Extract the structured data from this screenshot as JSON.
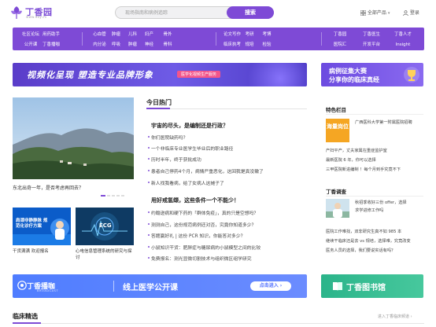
{
  "header": {
    "logo_text": "丁香园",
    "logo_url_text": "www.dxy.cn",
    "search_placeholder": "现场指南和病例追踪",
    "search_button": "搜索",
    "all_products": "全部产品",
    "login": "登录"
  },
  "nav": {
    "groups": [
      {
        "cols": 2,
        "items": [
          "社区论坛",
          "用药助手",
          "公开课",
          "丁香播咖"
        ]
      },
      {
        "cols": 4,
        "items": [
          "心血管",
          "肿瘤",
          "儿科",
          "妇产",
          "内分泌",
          "呼吸",
          "肿瘤",
          "神经"
        ]
      },
      {
        "cols": 1,
        "items": [
          "骨外",
          "骨科"
        ]
      },
      {
        "cols": 3,
        "items": [
          "论文写作",
          "考研",
          "考博",
          "临床执考",
          "规培",
          "检验"
        ]
      },
      {
        "cols": 2,
        "items": [
          "丁香园",
          "丁香医生",
          "丁香人才",
          "医院汇",
          "开发平台",
          "Insight"
        ]
      }
    ]
  },
  "banner": {
    "title": "视频化呈现 塑造专业品牌形象",
    "tag": "医学化视频生产服务",
    "right_line1": "病例征集大赛",
    "right_line2": "分享你的临床真经"
  },
  "hero": {
    "caption": "东北出奇一年，是否考虑再回去？"
  },
  "thumbs": [
    {
      "caption": "干货满满 欢迎报名",
      "img_text": "肩颈非静静脉 规范化诊疗方案"
    },
    {
      "caption": "心电信息管理系统的研究与探讨",
      "img_text": "ECG"
    }
  ],
  "today_hot": {
    "title": "今日热门",
    "sections": [
      {
        "head": "宇宙的尽头，是编制还是行政？",
        "items": [
          "你们医院缺药吗？",
          "一个非临床专业医学生毕业后的职业路径",
          "历时半年，终于获批成功",
          "患者自己停药4个月，病情严重恶化，这回我是真没辙了",
          "新人找我看病，给了女病人这摊子了"
        ]
      },
      {
        "head": "用好戒氢缬，这些条件一个不能少！",
        "items": [
          "约翰逊病和硬下药的「群体免疫」，真的只是空想吗？",
          "测测自己，这份规范病例还对否，究竟你知道多少？",
          "答题赢好礼 | 这份 PCR 知识，你能答对多少？",
          "小鼠知识干货：肥胖症与糖尿病的小鼠模型之间的比较",
          "免费报名：测光显微切割技术与组织微区组学研究"
        ]
      }
    ]
  },
  "sidebar": {
    "special_title": "特色栏目",
    "special_img": "海量岗位",
    "special_lines": [
      "广西医科大学第一附属医院招聘",
      "产妇平产，丈夫家属在重症监护室",
      "最新医院 6 年，你可以选择",
      "三甲医院新进编制 ！每个月到手究竟不下"
    ],
    "survey_title": "丁香调查",
    "survey_lines": [
      "秋招季收好三份 offer，选择",
      "求学进修工作吗",
      "医院工作难找，双非研究生真不如 985 本",
      "继续干临床还是去 vs 规培，选择难，究竟改变",
      "医务人员的选择，我们要说实话有吗？"
    ]
  },
  "broadcast": {
    "logo": "丁香播咖",
    "logo_sub": "BROADCAST",
    "text": "线上医学公开课",
    "button": "点击进入 ›"
  },
  "library": {
    "text": "丁香图书馆"
  },
  "clinical": {
    "title": "临床精选",
    "more": "进入丁香临床频道 ›"
  },
  "colors": {
    "brand": "#7e4ad6",
    "broadcast": "#4f7dff",
    "library": "#2bb48a",
    "special": "#f5a623"
  }
}
